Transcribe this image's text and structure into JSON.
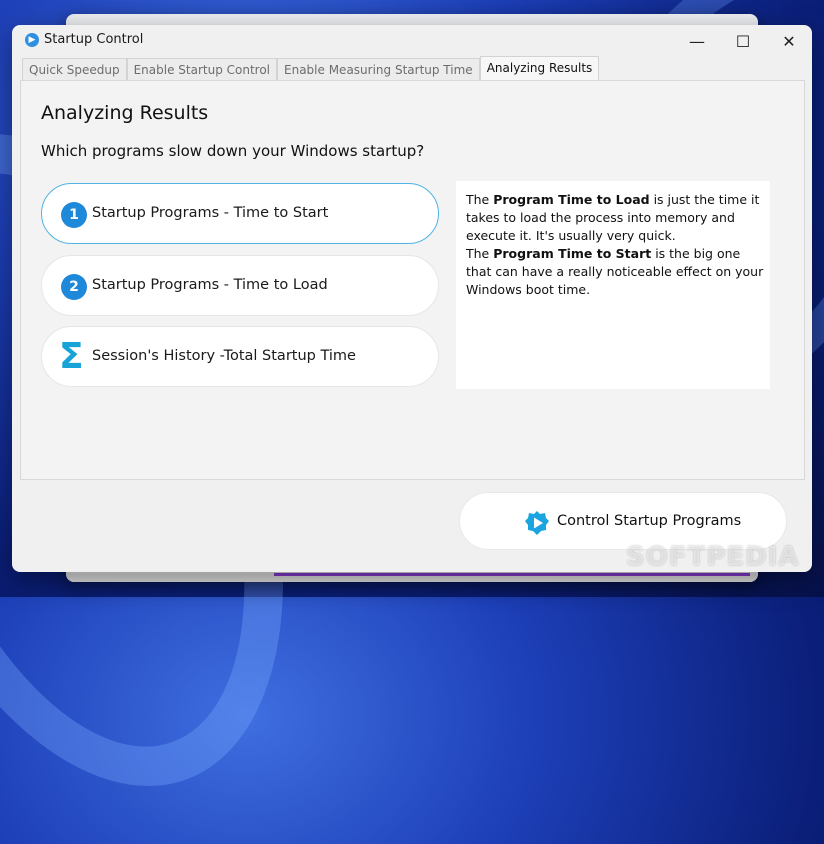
{
  "window": {
    "title": "Startup Control",
    "controls": {
      "minimize": "—",
      "maximize": "☐",
      "close": "✕"
    }
  },
  "tabs": [
    {
      "label": "Quick Speedup",
      "active": false
    },
    {
      "label": "Enable Startup Control",
      "active": false
    },
    {
      "label": "Enable Measuring Startup Time",
      "active": false
    },
    {
      "label": "Analyzing Results",
      "active": true
    }
  ],
  "main": {
    "heading": "Analyzing Results",
    "subheading": "Which programs slow down your Windows startup?",
    "options": [
      {
        "badge": "1",
        "icon": "number-badge-icon",
        "label": "Startup Programs - Time to Start",
        "selected": true
      },
      {
        "badge": "2",
        "icon": "number-badge-icon",
        "label": "Startup Programs - Time to Load",
        "selected": false
      },
      {
        "badge": "Σ",
        "icon": "sigma-icon",
        "label": "Session's History -Total Startup Time",
        "selected": false
      }
    ],
    "info": {
      "p1_prefix": "The ",
      "p1_bold": "Program Time to Load",
      "p1_suffix": " is just the time it takes to load the process into memory and execute it. It's usually very quick.",
      "p2_prefix": "The ",
      "p2_bold": "Program Time to Start",
      "p2_suffix": " is the big one that can have a really noticeable effect on your Windows boot time."
    }
  },
  "footer": {
    "control_button": "Control Startup Programs",
    "control_icon": "play-gear-icon"
  },
  "watermark": "SOFTPEDIA",
  "colors": {
    "accent": "#1e88d9",
    "selected_border": "#4fb3e6",
    "sigma": "#18a3d8"
  }
}
